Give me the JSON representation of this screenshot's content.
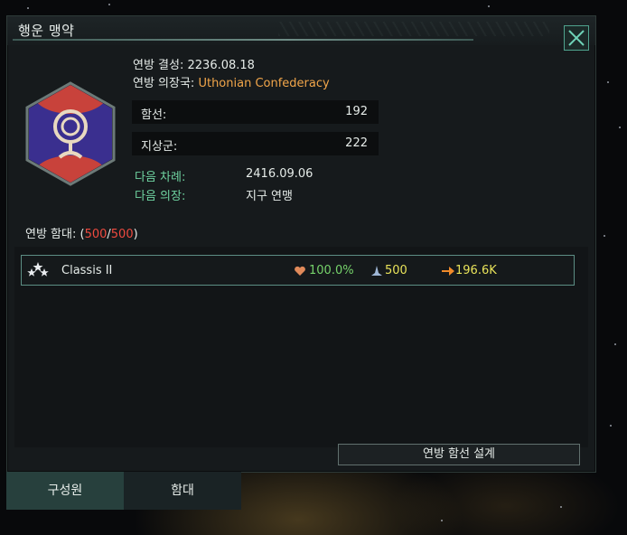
{
  "window": {
    "title": "행운 맹약",
    "close_icon": "close-icon"
  },
  "federation": {
    "founded_label": "연방 결성:",
    "founded_value": "2236.08.18",
    "president_label": "연방 의장국:",
    "president_value": "Uthonian Confederacy",
    "emblem_icon": "federation-emblem-icon",
    "ships_label": "함선:",
    "ships_value": "192",
    "armies_label": "지상군:",
    "armies_value": "222",
    "next_turn_label": "다음 차례:",
    "next_turn_value": "2416.09.06",
    "next_president_label": "다음 의장:",
    "next_president_value": "지구 연맹"
  },
  "fleet_section": {
    "heading_prefix": "연방 함대: (",
    "current": "500",
    "separator": "/",
    "max": "500",
    "heading_suffix": ")"
  },
  "fleets": [
    {
      "icon": "admiral-stars-icon",
      "name": "Classis II",
      "health": "100.0%",
      "ships": "500",
      "power": "196.6K"
    }
  ],
  "actions": {
    "design_button": "연방 함선 설계"
  },
  "tabs": [
    {
      "label": "구성원",
      "active": false
    },
    {
      "label": "함대",
      "active": true
    }
  ],
  "colors": {
    "accent": "#5c8e84",
    "highlight_orange": "#f2a64a",
    "highlight_green": "#6fd3a0",
    "fleet_count_red": "#ef4a3f",
    "emblem_purple": "#3a2f8f",
    "emblem_red": "#c8423b"
  }
}
